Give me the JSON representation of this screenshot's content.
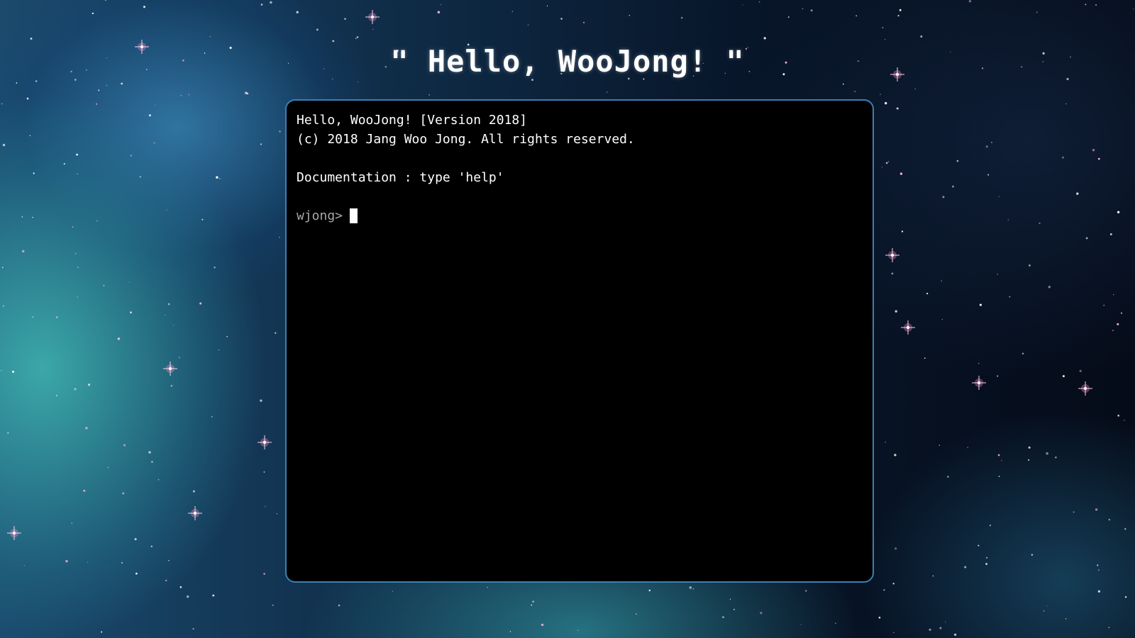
{
  "page": {
    "title": "\" Hello, WooJong! \""
  },
  "terminal": {
    "lines": [
      "Hello, WooJong! [Version 2018]",
      "(c) 2018 Jang Woo Jong. All rights reserved.",
      "",
      "Documentation : type 'help'",
      ""
    ],
    "prompt": "wjong>",
    "input_value": ""
  },
  "colors": {
    "terminal_bg": "#000000",
    "terminal_border": "#3d7fb4",
    "text": "#ffffff",
    "prompt": "#a8a8a8"
  }
}
